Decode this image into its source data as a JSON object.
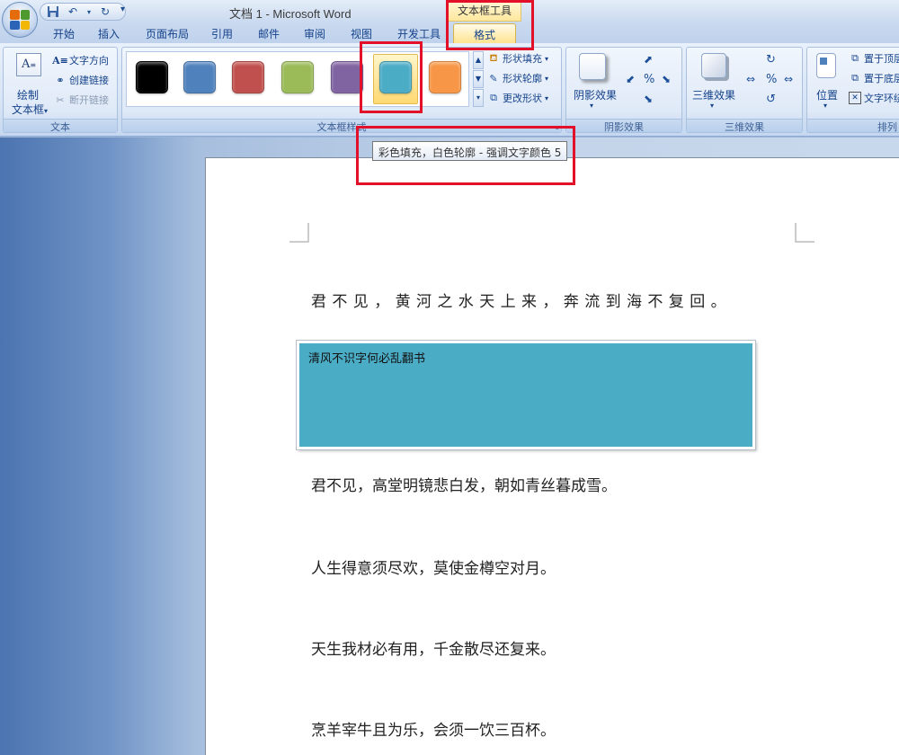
{
  "window": {
    "title": "文档 1 - Microsoft Word"
  },
  "context_tab": {
    "title": "文本框工具"
  },
  "tabs": [
    {
      "label": "开始"
    },
    {
      "label": "插入"
    },
    {
      "label": "页面布局"
    },
    {
      "label": "引用"
    },
    {
      "label": "邮件"
    },
    {
      "label": "审阅"
    },
    {
      "label": "视图"
    },
    {
      "label": "开发工具"
    },
    {
      "label": "格式",
      "active": true
    }
  ],
  "ribbon": {
    "text_group": {
      "label": "文本",
      "draw_textbox_line1": "绘制",
      "draw_textbox_line2": "文本框",
      "text_direction": "文字方向",
      "create_link": "创建链接",
      "break_link": "断开链接"
    },
    "style_group": {
      "label": "文本框样式",
      "swatches": [
        "#000000",
        "#4f81bd",
        "#c0504d",
        "#9bbb59",
        "#8064a2",
        "#4bacc6",
        "#f79646"
      ],
      "selected_index": 5,
      "shape_fill": "形状填充",
      "shape_outline": "形状轮廓",
      "change_shape": "更改形状"
    },
    "shadow_group": {
      "label": "阴影效果",
      "button": "阴影效果"
    },
    "threed_group": {
      "label": "三维效果",
      "button": "三维效果"
    },
    "arrange_group": {
      "label": "排列",
      "position": "位置",
      "bring_front": "置于顶层",
      "send_back": "置于底层",
      "text_wrap": "文字环绕"
    }
  },
  "tooltip": {
    "text": "彩色填充，白色轮廓 - 强调文字颜色 5"
  },
  "document": {
    "line1": "君不见，黄河之水天上来，奔流到海不复回。",
    "textbox_text": "清风不识字何必乱翻书",
    "line2": "君不见，高堂明镜悲白发，朝如青丝暮成雪。",
    "line3": "人生得意须尽欢，莫使金樽空对月。",
    "line4": "天生我材必有用，千金散尽还复来。",
    "line5": "烹羊宰牛且为乐，会须一饮三百杯。"
  },
  "colors": {
    "textbox_fill": "#4bacc6",
    "highlight": "#e3102a"
  }
}
